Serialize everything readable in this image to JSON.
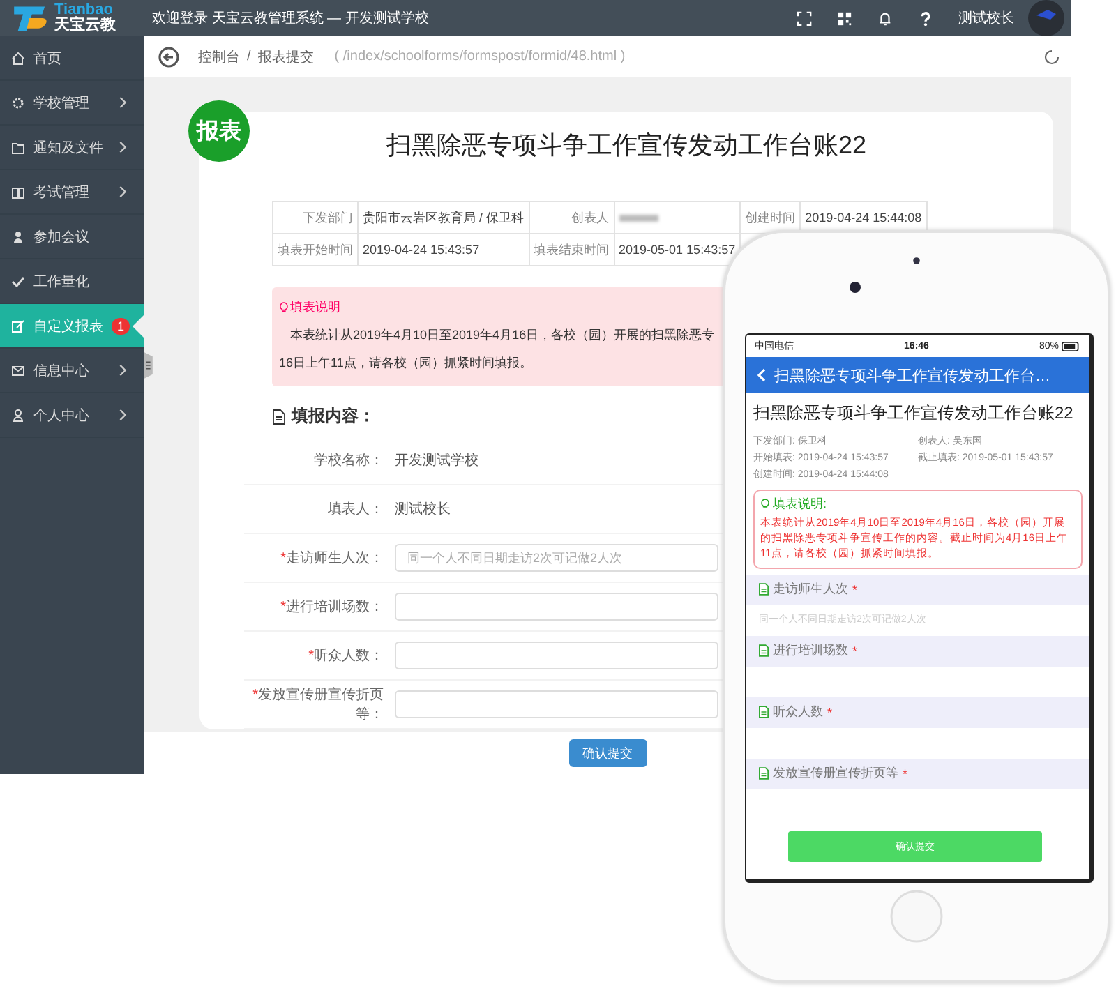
{
  "topbar": {
    "logo_latin": "Tianbao",
    "logo_name": "天宝云教",
    "welcome": "欢迎登录 天宝云教管理系统 — 开发测试学校",
    "user": "测试校长"
  },
  "sidebar": {
    "items": [
      {
        "label": "首页",
        "submenu": false,
        "selected": false
      },
      {
        "label": "学校管理",
        "submenu": true,
        "selected": false
      },
      {
        "label": "通知及文件",
        "submenu": true,
        "selected": false
      },
      {
        "label": "考试管理",
        "submenu": true,
        "selected": false
      },
      {
        "label": "参加会议",
        "submenu": false,
        "selected": false
      },
      {
        "label": "工作量化",
        "submenu": false,
        "selected": false
      },
      {
        "label": "自定义报表",
        "submenu": false,
        "selected": true,
        "badge": "1"
      },
      {
        "label": "信息中心",
        "submenu": true,
        "selected": false
      },
      {
        "label": "个人中心",
        "submenu": true,
        "selected": false
      }
    ]
  },
  "breadcrumb": {
    "items": [
      "控制台",
      "报表提交"
    ],
    "separator": "/",
    "path": "( /index/schoolforms/formspost/formid/48.html )"
  },
  "form": {
    "badge": "报表",
    "title": "扫黑除恶专项斗争工作宣传发动工作台账22",
    "info_rows": [
      [
        {
          "label": "下发部门",
          "value": "贵阳市云岩区教育局 / 保卫科"
        },
        {
          "label": "创表人",
          "redacted": true
        },
        {
          "label": "创建时间",
          "value": "2019-04-24 15:44:08"
        }
      ],
      [
        {
          "label": "填表开始时间",
          "value": "2019-04-24 15:43:57"
        },
        {
          "label": "填表结束时间",
          "value": "2019-05-01 15:43:57"
        }
      ]
    ],
    "notice_title": "填表说明",
    "notice_lines": [
      "本表统计从2019年4月10日至2019年4月16日，各校（园）开展的扫黑除恶专",
      "16日上午11点，请各校（园）抓紧时间填报。"
    ],
    "section": "填报内容：",
    "fields": [
      {
        "kind": "text",
        "label": "学校名称：",
        "value": "开发测试学校"
      },
      {
        "kind": "text",
        "label": "填表人：",
        "value": "测试校长"
      },
      {
        "kind": "input",
        "mark": "*",
        "label": "走访师生人次：",
        "placeholder": "同一个人不同日期走访2次可记做2人次"
      },
      {
        "kind": "input",
        "mark": "*",
        "label": "进行培训场数："
      },
      {
        "kind": "input",
        "mark": "*",
        "label": "听众人数："
      },
      {
        "kind": "input",
        "mark": "*",
        "label": "发放宣传册宣传折页等："
      }
    ],
    "submit": "确认提交"
  },
  "phone": {
    "carrier": "中国电信",
    "time": "16:46",
    "battery": "80%",
    "header": "扫黑除恶专项斗争工作宣传发动工作台…",
    "title": "扫黑除恶专项斗争工作宣传发动工作台账22",
    "meta": [
      "下发部门: 保卫科",
      "创表人: 吴东国",
      "开始填表: 2019-04-24 15:43:57",
      "截止填表: 2019-05-01 15:43:57",
      "创建时间: 2019-04-24 15:44:08"
    ],
    "notice_title": "填表说明:",
    "notice_text": "本表统计从2019年4月10日至2019年4月16日，各校（园）开展的扫黑除恶专项斗争宣传工作的内容。截止时间为4月16日上午11点，请各校（园）抓紧时间填报。",
    "fields": [
      {
        "label": "走访师生人次",
        "mark": "*",
        "placeholder": "同一个人不同日期走访2次可记做2人次"
      },
      {
        "label": "进行培训场数",
        "mark": "*"
      },
      {
        "label": "听众人数",
        "mark": "*"
      },
      {
        "label": "发放宣传册宣传折页等",
        "mark": "*"
      }
    ],
    "submit": "确认提交"
  }
}
